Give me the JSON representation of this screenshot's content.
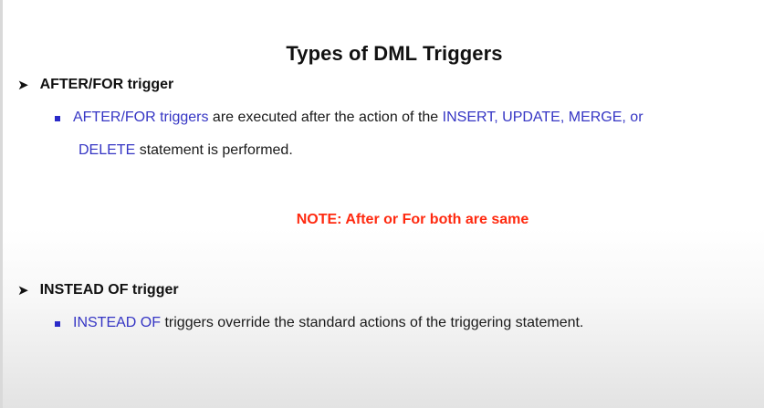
{
  "slide": {
    "title": "Types of DML Triggers",
    "sections": [
      {
        "heading": "AFTER/FOR trigger",
        "bullet": {
          "lead": "AFTER/FOR triggers",
          "text1": " are executed after the action of the ",
          "hl2": "INSERT, UPDATE, MERGE, or",
          "hl3": "DELETE",
          "text2": " statement is performed."
        }
      },
      {
        "heading": "INSTEAD OF trigger",
        "bullet": {
          "lead": "INSTEAD OF",
          "text1": " triggers override the standard actions of the triggering statement."
        }
      }
    ],
    "note": "NOTE: After or For both are same"
  },
  "colors": {
    "highlight": "#3535c4",
    "note": "#ff2a10",
    "bullet_square": "#2a2ac8"
  },
  "icons": {
    "section_marker": "arrowhead-bullet-icon",
    "item_marker": "square-bullet-icon"
  }
}
